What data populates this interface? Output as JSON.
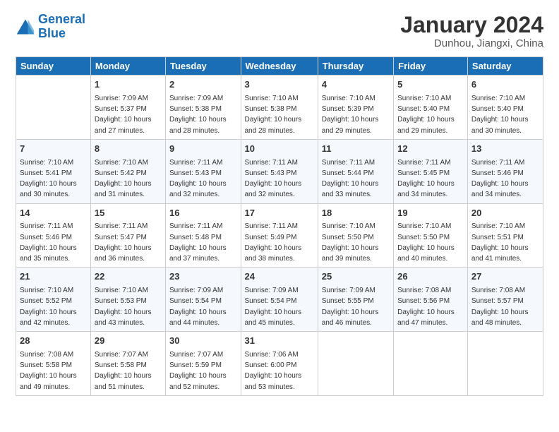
{
  "logo": {
    "line1": "General",
    "line2": "Blue"
  },
  "title": "January 2024",
  "location": "Dunhou, Jiangxi, China",
  "days_of_week": [
    "Sunday",
    "Monday",
    "Tuesday",
    "Wednesday",
    "Thursday",
    "Friday",
    "Saturday"
  ],
  "weeks": [
    [
      {
        "day": "",
        "sunrise": "",
        "sunset": "",
        "daylight": ""
      },
      {
        "day": "1",
        "sunrise": "Sunrise: 7:09 AM",
        "sunset": "Sunset: 5:37 PM",
        "daylight": "Daylight: 10 hours and 27 minutes."
      },
      {
        "day": "2",
        "sunrise": "Sunrise: 7:09 AM",
        "sunset": "Sunset: 5:38 PM",
        "daylight": "Daylight: 10 hours and 28 minutes."
      },
      {
        "day": "3",
        "sunrise": "Sunrise: 7:10 AM",
        "sunset": "Sunset: 5:38 PM",
        "daylight": "Daylight: 10 hours and 28 minutes."
      },
      {
        "day": "4",
        "sunrise": "Sunrise: 7:10 AM",
        "sunset": "Sunset: 5:39 PM",
        "daylight": "Daylight: 10 hours and 29 minutes."
      },
      {
        "day": "5",
        "sunrise": "Sunrise: 7:10 AM",
        "sunset": "Sunset: 5:40 PM",
        "daylight": "Daylight: 10 hours and 29 minutes."
      },
      {
        "day": "6",
        "sunrise": "Sunrise: 7:10 AM",
        "sunset": "Sunset: 5:40 PM",
        "daylight": "Daylight: 10 hours and 30 minutes."
      }
    ],
    [
      {
        "day": "7",
        "sunrise": "Sunrise: 7:10 AM",
        "sunset": "Sunset: 5:41 PM",
        "daylight": "Daylight: 10 hours and 30 minutes."
      },
      {
        "day": "8",
        "sunrise": "Sunrise: 7:10 AM",
        "sunset": "Sunset: 5:42 PM",
        "daylight": "Daylight: 10 hours and 31 minutes."
      },
      {
        "day": "9",
        "sunrise": "Sunrise: 7:11 AM",
        "sunset": "Sunset: 5:43 PM",
        "daylight": "Daylight: 10 hours and 32 minutes."
      },
      {
        "day": "10",
        "sunrise": "Sunrise: 7:11 AM",
        "sunset": "Sunset: 5:43 PM",
        "daylight": "Daylight: 10 hours and 32 minutes."
      },
      {
        "day": "11",
        "sunrise": "Sunrise: 7:11 AM",
        "sunset": "Sunset: 5:44 PM",
        "daylight": "Daylight: 10 hours and 33 minutes."
      },
      {
        "day": "12",
        "sunrise": "Sunrise: 7:11 AM",
        "sunset": "Sunset: 5:45 PM",
        "daylight": "Daylight: 10 hours and 34 minutes."
      },
      {
        "day": "13",
        "sunrise": "Sunrise: 7:11 AM",
        "sunset": "Sunset: 5:46 PM",
        "daylight": "Daylight: 10 hours and 34 minutes."
      }
    ],
    [
      {
        "day": "14",
        "sunrise": "Sunrise: 7:11 AM",
        "sunset": "Sunset: 5:46 PM",
        "daylight": "Daylight: 10 hours and 35 minutes."
      },
      {
        "day": "15",
        "sunrise": "Sunrise: 7:11 AM",
        "sunset": "Sunset: 5:47 PM",
        "daylight": "Daylight: 10 hours and 36 minutes."
      },
      {
        "day": "16",
        "sunrise": "Sunrise: 7:11 AM",
        "sunset": "Sunset: 5:48 PM",
        "daylight": "Daylight: 10 hours and 37 minutes."
      },
      {
        "day": "17",
        "sunrise": "Sunrise: 7:11 AM",
        "sunset": "Sunset: 5:49 PM",
        "daylight": "Daylight: 10 hours and 38 minutes."
      },
      {
        "day": "18",
        "sunrise": "Sunrise: 7:10 AM",
        "sunset": "Sunset: 5:50 PM",
        "daylight": "Daylight: 10 hours and 39 minutes."
      },
      {
        "day": "19",
        "sunrise": "Sunrise: 7:10 AM",
        "sunset": "Sunset: 5:50 PM",
        "daylight": "Daylight: 10 hours and 40 minutes."
      },
      {
        "day": "20",
        "sunrise": "Sunrise: 7:10 AM",
        "sunset": "Sunset: 5:51 PM",
        "daylight": "Daylight: 10 hours and 41 minutes."
      }
    ],
    [
      {
        "day": "21",
        "sunrise": "Sunrise: 7:10 AM",
        "sunset": "Sunset: 5:52 PM",
        "daylight": "Daylight: 10 hours and 42 minutes."
      },
      {
        "day": "22",
        "sunrise": "Sunrise: 7:10 AM",
        "sunset": "Sunset: 5:53 PM",
        "daylight": "Daylight: 10 hours and 43 minutes."
      },
      {
        "day": "23",
        "sunrise": "Sunrise: 7:09 AM",
        "sunset": "Sunset: 5:54 PM",
        "daylight": "Daylight: 10 hours and 44 minutes."
      },
      {
        "day": "24",
        "sunrise": "Sunrise: 7:09 AM",
        "sunset": "Sunset: 5:54 PM",
        "daylight": "Daylight: 10 hours and 45 minutes."
      },
      {
        "day": "25",
        "sunrise": "Sunrise: 7:09 AM",
        "sunset": "Sunset: 5:55 PM",
        "daylight": "Daylight: 10 hours and 46 minutes."
      },
      {
        "day": "26",
        "sunrise": "Sunrise: 7:08 AM",
        "sunset": "Sunset: 5:56 PM",
        "daylight": "Daylight: 10 hours and 47 minutes."
      },
      {
        "day": "27",
        "sunrise": "Sunrise: 7:08 AM",
        "sunset": "Sunset: 5:57 PM",
        "daylight": "Daylight: 10 hours and 48 minutes."
      }
    ],
    [
      {
        "day": "28",
        "sunrise": "Sunrise: 7:08 AM",
        "sunset": "Sunset: 5:58 PM",
        "daylight": "Daylight: 10 hours and 49 minutes."
      },
      {
        "day": "29",
        "sunrise": "Sunrise: 7:07 AM",
        "sunset": "Sunset: 5:58 PM",
        "daylight": "Daylight: 10 hours and 51 minutes."
      },
      {
        "day": "30",
        "sunrise": "Sunrise: 7:07 AM",
        "sunset": "Sunset: 5:59 PM",
        "daylight": "Daylight: 10 hours and 52 minutes."
      },
      {
        "day": "31",
        "sunrise": "Sunrise: 7:06 AM",
        "sunset": "Sunset: 6:00 PM",
        "daylight": "Daylight: 10 hours and 53 minutes."
      },
      {
        "day": "",
        "sunrise": "",
        "sunset": "",
        "daylight": ""
      },
      {
        "day": "",
        "sunrise": "",
        "sunset": "",
        "daylight": ""
      },
      {
        "day": "",
        "sunrise": "",
        "sunset": "",
        "daylight": ""
      }
    ]
  ]
}
